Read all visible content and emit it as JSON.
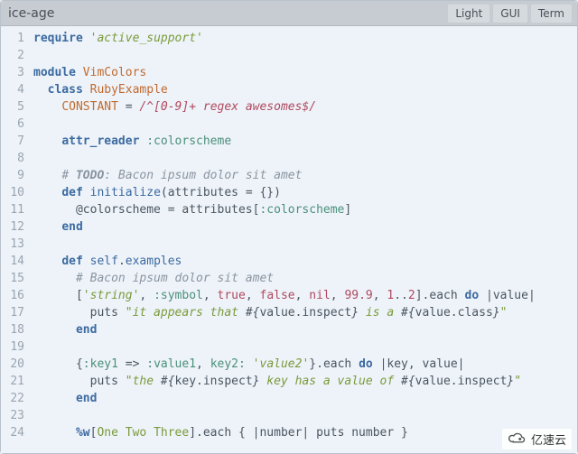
{
  "window": {
    "title": "ice-age",
    "tabs": [
      {
        "label": "Light"
      },
      {
        "label": "GUI"
      },
      {
        "label": "Term"
      }
    ]
  },
  "gutter": {
    "start": 1,
    "end": 24
  },
  "code": {
    "lines": [
      [
        [
          "kw",
          "require"
        ],
        [
          "punct",
          " "
        ],
        [
          "str",
          "'active_support'"
        ]
      ],
      [],
      [
        [
          "kw",
          "module"
        ],
        [
          "punct",
          " "
        ],
        [
          "const",
          "VimColors"
        ]
      ],
      [
        [
          "punct",
          "  "
        ],
        [
          "kw",
          "class"
        ],
        [
          "punct",
          " "
        ],
        [
          "const",
          "RubyExample"
        ]
      ],
      [
        [
          "punct",
          "    "
        ],
        [
          "const",
          "CONSTANT"
        ],
        [
          "punct",
          " = "
        ],
        [
          "regex",
          "/^[0-9]+ regex awesomes$/"
        ]
      ],
      [],
      [
        [
          "punct",
          "    "
        ],
        [
          "kw",
          "attr_reader"
        ],
        [
          "punct",
          " "
        ],
        [
          "sym",
          ":colorscheme"
        ]
      ],
      [],
      [
        [
          "punct",
          "    "
        ],
        [
          "comment",
          "# "
        ],
        [
          "todo",
          "TODO"
        ],
        [
          "comment",
          ": Bacon ipsum dolor sit amet"
        ]
      ],
      [
        [
          "punct",
          "    "
        ],
        [
          "kw",
          "def"
        ],
        [
          "punct",
          " "
        ],
        [
          "func",
          "initialize"
        ],
        [
          "punct",
          "(attributes = {})"
        ]
      ],
      [
        [
          "punct",
          "      "
        ],
        [
          "punct",
          "@colorscheme = attributes["
        ],
        [
          "sym",
          ":colorscheme"
        ],
        [
          "punct",
          "]"
        ]
      ],
      [
        [
          "punct",
          "    "
        ],
        [
          "kw",
          "end"
        ]
      ],
      [],
      [
        [
          "punct",
          "    "
        ],
        [
          "kw",
          "def"
        ],
        [
          "punct",
          " "
        ],
        [
          "func",
          "self"
        ],
        [
          "punct",
          "."
        ],
        [
          "func",
          "examples"
        ]
      ],
      [
        [
          "punct",
          "      "
        ],
        [
          "comment",
          "# Bacon ipsum dolor sit amet"
        ]
      ],
      [
        [
          "punct",
          "      ["
        ],
        [
          "str",
          "'string'"
        ],
        [
          "punct",
          ", "
        ],
        [
          "sym",
          ":symbol"
        ],
        [
          "punct",
          ", "
        ],
        [
          "bool",
          "true"
        ],
        [
          "punct",
          ", "
        ],
        [
          "bool",
          "false"
        ],
        [
          "punct",
          ", "
        ],
        [
          "bool",
          "nil"
        ],
        [
          "punct",
          ", "
        ],
        [
          "num",
          "99.9"
        ],
        [
          "punct",
          ", "
        ],
        [
          "num",
          "1"
        ],
        [
          "punct",
          ".."
        ],
        [
          "num",
          "2"
        ],
        [
          "punct",
          "].each "
        ],
        [
          "kw",
          "do"
        ],
        [
          "punct",
          " |value|"
        ]
      ],
      [
        [
          "punct",
          "        puts "
        ],
        [
          "str",
          "\"it appears that "
        ],
        [
          "interp",
          "#{"
        ],
        [
          "punct",
          "value.inspect"
        ],
        [
          "interp",
          "}"
        ],
        [
          "str",
          " is a "
        ],
        [
          "interp",
          "#{"
        ],
        [
          "punct",
          "value.class"
        ],
        [
          "interp",
          "}"
        ],
        [
          "str",
          "\""
        ]
      ],
      [
        [
          "punct",
          "      "
        ],
        [
          "kw",
          "end"
        ]
      ],
      [],
      [
        [
          "punct",
          "      {"
        ],
        [
          "sym",
          ":key1"
        ],
        [
          "punct",
          " => "
        ],
        [
          "sym",
          ":value1"
        ],
        [
          "punct",
          ", "
        ],
        [
          "sym",
          "key2:"
        ],
        [
          "punct",
          " "
        ],
        [
          "str",
          "'value2'"
        ],
        [
          "punct",
          "}.each "
        ],
        [
          "kw",
          "do"
        ],
        [
          "punct",
          " |key, value|"
        ]
      ],
      [
        [
          "punct",
          "        puts "
        ],
        [
          "str",
          "\"the "
        ],
        [
          "interp",
          "#{"
        ],
        [
          "punct",
          "key.inspect"
        ],
        [
          "interp",
          "}"
        ],
        [
          "str",
          " key has a value of "
        ],
        [
          "interp",
          "#{"
        ],
        [
          "punct",
          "value.inspect"
        ],
        [
          "interp",
          "}"
        ],
        [
          "str",
          "\""
        ]
      ],
      [
        [
          "punct",
          "      "
        ],
        [
          "kw",
          "end"
        ]
      ],
      [],
      [
        [
          "punct",
          "      "
        ],
        [
          "kw",
          "%w"
        ],
        [
          "punct",
          "["
        ],
        [
          "word",
          "One Two Three"
        ],
        [
          "punct",
          "].each { |number| puts number }"
        ]
      ]
    ]
  },
  "watermark": {
    "text": "亿速云"
  }
}
